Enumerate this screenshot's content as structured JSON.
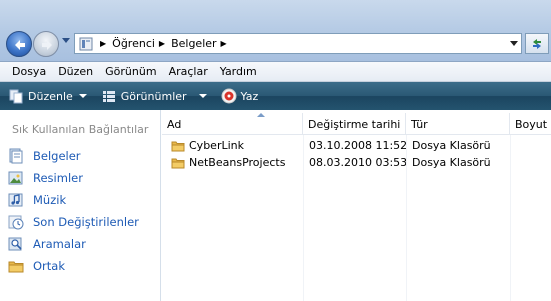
{
  "address": {
    "crumbs": [
      "Öğrenci",
      "Belgeler"
    ]
  },
  "menubar": [
    "Dosya",
    "Düzen",
    "Görünüm",
    "Araçlar",
    "Yardım"
  ],
  "commands": {
    "organize": "Düzenle",
    "views": "Görünümler",
    "burn": "Yaz"
  },
  "nav": {
    "header": "Sık Kullanılan Bağlantılar",
    "items": [
      {
        "label": "Belgeler",
        "icon": "documents-icon"
      },
      {
        "label": "Resimler",
        "icon": "pictures-icon"
      },
      {
        "label": "Müzik",
        "icon": "music-icon"
      },
      {
        "label": "Son Değiştirilenler",
        "icon": "recent-icon"
      },
      {
        "label": "Aramalar",
        "icon": "searches-icon"
      },
      {
        "label": "Ortak",
        "icon": "public-folder-icon"
      }
    ]
  },
  "columns": [
    "Ad",
    "Değiştirme tarihi",
    "Tür",
    "Boyut"
  ],
  "files": [
    {
      "name": "CyberLink",
      "date": "03.10.2008 11:52",
      "type": "Dosya Klasörü",
      "size": ""
    },
    {
      "name": "NetBeansProjects",
      "date": "08.03.2010 03:53",
      "type": "Dosya Klasörü",
      "size": ""
    }
  ],
  "colors": {
    "command_bar": "#24536e",
    "link": "#1e5bb5",
    "folder": "#e8b84a"
  }
}
